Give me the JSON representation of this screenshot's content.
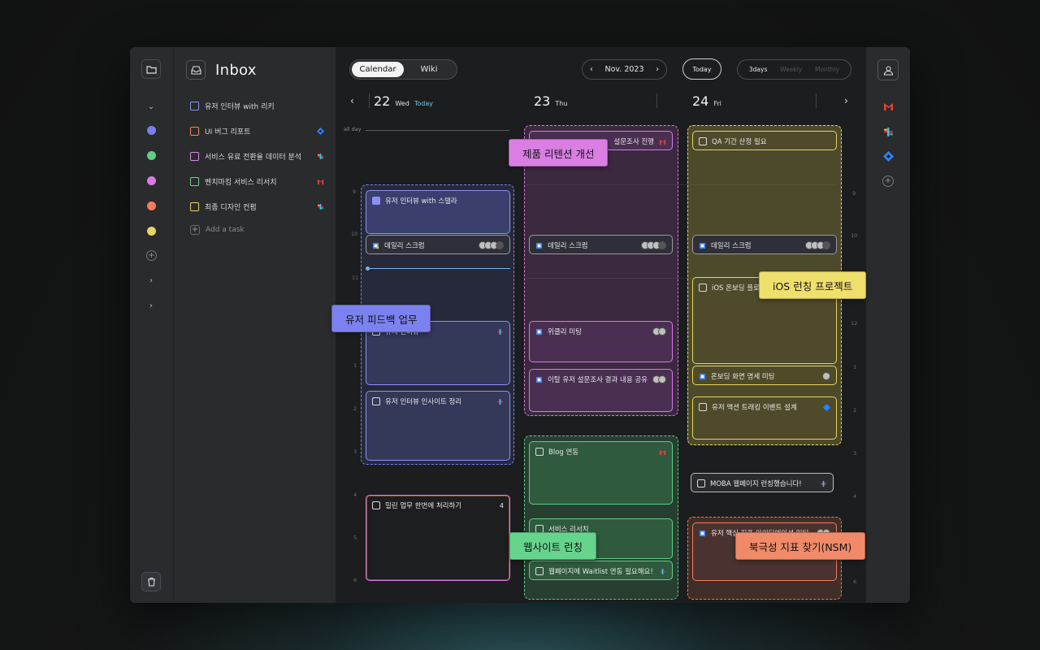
{
  "inbox": {
    "title": "Inbox",
    "tasks": [
      {
        "label": "유저 인터뷰 with 리키",
        "color": "#8a8ff2"
      },
      {
        "label": "UI 버그 리포트",
        "color": "#ef8a62",
        "source": "jira-icon"
      },
      {
        "label": "서비스 유료 전환율 데이터 분석",
        "color": "#d98ae8",
        "source": "slack-icon"
      },
      {
        "label": "벤치마킹 서비스 리서치",
        "color": "#72d08e",
        "source": "gmail-icon"
      },
      {
        "label": "최종 디자인 컨펌",
        "color": "#e9d86a",
        "source": "slack-icon"
      }
    ],
    "add_task": "Add a task"
  },
  "rail": {
    "project_colors": [
      "#7b7ef0",
      "#5fcf86",
      "#d87ae6",
      "#ef7d5c",
      "#e8d466"
    ]
  },
  "toolbar": {
    "tabs": [
      "Calendar",
      "Wiki"
    ],
    "month": "Nov. 2023",
    "today": "Today",
    "views": [
      "3days",
      "Weekly",
      "Monthly"
    ]
  },
  "days": [
    {
      "num": "22",
      "name": "Wed",
      "today": "Today"
    },
    {
      "num": "23",
      "name": "Thu"
    },
    {
      "num": "24",
      "name": "Fri"
    }
  ],
  "all_day": "all day",
  "hours_left": [
    "9",
    "10",
    "11",
    "12",
    "1",
    "2",
    "3",
    "4",
    "5",
    "6"
  ],
  "hours_right": [
    "9",
    "10",
    "11",
    "12",
    "1",
    "2",
    "3",
    "4",
    "5",
    "6"
  ],
  "events": {
    "wed_interview": "유저 인터뷰 with 스텔라",
    "wed_scrum": "데일리 스크럼",
    "wed_hidden": "유저 인터뷰",
    "wed_insight": "유저 인터뷰 인사이트 정리",
    "wed_backlog": "밀린 업무 한번에 처리하기",
    "wed_backlog_count": "4",
    "thu_survey": "설문조사 진행",
    "thu_scrum": "데일리 스크럼",
    "thu_weekly": "위클리 미팅",
    "thu_churn": "이탈 유저 설문조사 결과 내용 공유",
    "thu_blog": "Blog 연동",
    "thu_research": "서비스 리서치",
    "thu_waitlist": "웹페이지에 Waitlist 연동 필요해요!",
    "fri_qa": "QA 기간 산정 필요",
    "fri_scrum": "데일리 스크럼",
    "fri_onboarding": "iOS 온보딩 플로우",
    "fri_spec": "온보딩 화면 명세 미팅",
    "fri_tracking": "유저 액션 트래킹 이벤트 설계",
    "fri_moba": "MOBA 웹페이지 런칭했습니다!",
    "fri_metric": "유저 핵심 지표 아이디에이션 미팅"
  },
  "tooltips": {
    "retention": "제품 리텐션 개선",
    "feedback": "유저 피드백 업무",
    "ios": "iOS 런칭 프로젝트",
    "website": "웹사이트 런칭",
    "nsm": "북극성 지표 찾기(NSM)"
  },
  "colors": {
    "blue": "#7b82f0",
    "purple": "#d87ae6",
    "yellow": "#e8d466",
    "green": "#5fcf86",
    "orange": "#ef7d5c"
  }
}
